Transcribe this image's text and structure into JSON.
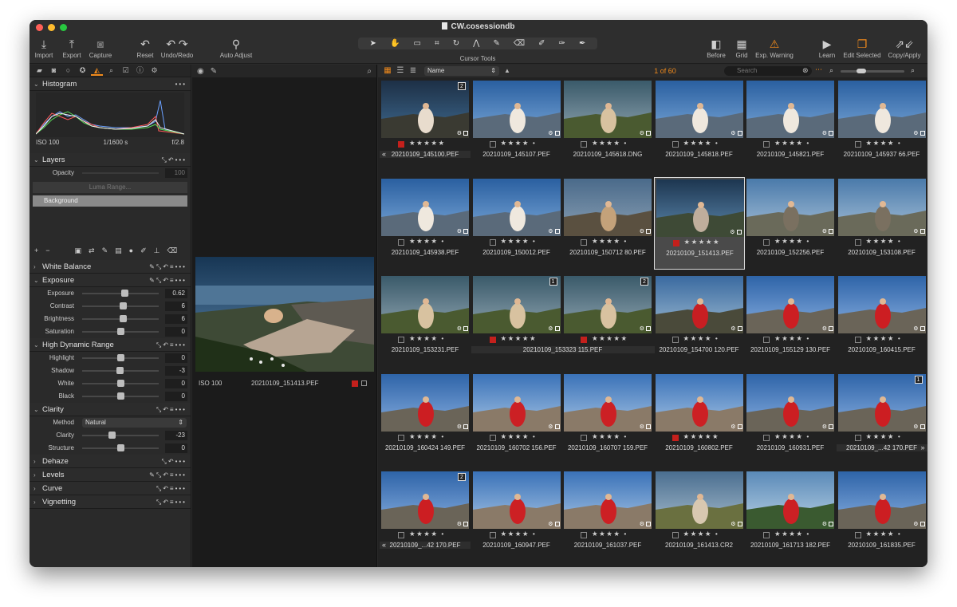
{
  "window": {
    "title": "CW.cosessiondb"
  },
  "toolbar": {
    "import_label": "Import",
    "export_label": "Export",
    "capture_label": "Capture",
    "reset_label": "Reset",
    "undo_redo_label": "Undo/Redo",
    "auto_adjust_label": "Auto Adjust",
    "cursor_tools_label": "Cursor Tools",
    "before_label": "Before",
    "grid_label": "Grid",
    "exp_warning_label": "Exp. Warning",
    "learn_label": "Learn",
    "edit_selected_label": "Edit Selected",
    "copy_apply_label": "Copy/Apply"
  },
  "histogram": {
    "title": "Histogram",
    "iso": "ISO 100",
    "shutter": "1/1600 s",
    "aperture": "f/2.8"
  },
  "layers": {
    "title": "Layers",
    "opacity_label": "Opacity",
    "opacity_value": "100",
    "luma_range_label": "Luma Range...",
    "background_label": "Background"
  },
  "white_balance": {
    "title": "White Balance"
  },
  "exposure": {
    "title": "Exposure",
    "sliders": [
      {
        "label": "Exposure",
        "value": "0.62",
        "pos": 0.55
      },
      {
        "label": "Contrast",
        "value": "6",
        "pos": 0.53
      },
      {
        "label": "Brightness",
        "value": "6",
        "pos": 0.53
      },
      {
        "label": "Saturation",
        "value": "0",
        "pos": 0.5
      }
    ]
  },
  "hdr": {
    "title": "High Dynamic Range",
    "sliders": [
      {
        "label": "Highlight",
        "value": "0",
        "pos": 0.5
      },
      {
        "label": "Shadow",
        "value": "-3",
        "pos": 0.49
      },
      {
        "label": "White",
        "value": "0",
        "pos": 0.5
      },
      {
        "label": "Black",
        "value": "0",
        "pos": 0.5
      }
    ]
  },
  "clarity": {
    "title": "Clarity",
    "method_label": "Method",
    "method_value": "Natural",
    "sliders": [
      {
        "label": "Clarity",
        "value": "-23",
        "pos": 0.39
      },
      {
        "label": "Structure",
        "value": "0",
        "pos": 0.5
      }
    ]
  },
  "dehaze": {
    "title": "Dehaze"
  },
  "levels": {
    "title": "Levels"
  },
  "curve": {
    "title": "Curve"
  },
  "vignetting": {
    "title": "Vignetting"
  },
  "viewer": {
    "iso": "ISO 100",
    "filename": "20210109_151413.PEF"
  },
  "browser": {
    "sort_value": "Name",
    "count": "1 of 60",
    "search_placeholder": "Search"
  },
  "thumbnails": [
    {
      "fn": "20210109_145100.PEF",
      "stars": "★★★★★",
      "red": true,
      "badge": "2",
      "arrow": "left",
      "stack": true,
      "tone": "a"
    },
    {
      "fn": "20210109_145107.PEF",
      "stars": "★★★★ •",
      "red": false,
      "tone": "b"
    },
    {
      "fn": "20210109_145618.DNG",
      "stars": "★★★★ •",
      "red": false,
      "tone": "c"
    },
    {
      "fn": "20210109_145818.PEF",
      "stars": "★★★★ •",
      "red": false,
      "tone": "b"
    },
    {
      "fn": "20210109_145821.PEF",
      "stars": "★★★★ •",
      "red": false,
      "tone": "b"
    },
    {
      "fn": "20210109_145937 66.PEF",
      "stars": "★★★★ •",
      "red": false,
      "tone": "b"
    },
    {
      "fn": "20210109_145938.PEF",
      "stars": "★★★★ •",
      "red": false,
      "tone": "b"
    },
    {
      "fn": "20210109_150012.PEF",
      "stars": "★★★★ •",
      "red": false,
      "tone": "b"
    },
    {
      "fn": "20210109_150712 80.PEF",
      "stars": "★★★★ •",
      "red": false,
      "tone": "d"
    },
    {
      "fn": "20210109_151413.PEF",
      "stars": "★★★★★",
      "red": true,
      "selected": true,
      "tone": "e"
    },
    {
      "fn": "20210109_152256.PEF",
      "stars": "★★★★ •",
      "red": false,
      "tone": "f"
    },
    {
      "fn": "20210109_153108.PEF",
      "stars": "★★★★ •",
      "red": false,
      "tone": "f"
    },
    {
      "fn": "20210109_153231.PEF",
      "stars": "★★★★ •",
      "red": false,
      "tone": "c"
    },
    {
      "fn": "20210109_153323 115.PEF",
      "stars": "★★★★★",
      "red": true,
      "badge": "1",
      "stack": true,
      "tone": "c",
      "span": true
    },
    {
      "fn": "",
      "stars": "★★★★★",
      "red": true,
      "badge": "2",
      "stack": true,
      "tone": "c"
    },
    {
      "fn": "20210109_154700 120.PEF",
      "stars": "★★★★ •",
      "red": false,
      "tone": "g"
    },
    {
      "fn": "20210109_155129 130.PEF",
      "stars": "★★★★ •",
      "red": false,
      "tone": "h"
    },
    {
      "fn": "20210109_160415.PEF",
      "stars": "★★★★ •",
      "red": false,
      "tone": "h"
    },
    {
      "fn": "20210109_160424 149.PEF",
      "stars": "★★★★ •",
      "red": false,
      "tone": "h"
    },
    {
      "fn": "20210109_160702 156.PEF",
      "stars": "★★★★ •",
      "red": false,
      "tone": "i"
    },
    {
      "fn": "20210109_160707 159.PEF",
      "stars": "★★★★ •",
      "red": false,
      "tone": "i"
    },
    {
      "fn": "20210109_160802.PEF",
      "stars": "★★★★★",
      "red": true,
      "tone": "i"
    },
    {
      "fn": "20210109_160931.PEF",
      "stars": "★★★★ •",
      "red": false,
      "tone": "h"
    },
    {
      "fn": "20210109_...42 170.PEF",
      "stars": "★★★★ •",
      "red": false,
      "badge": "1",
      "arrow": "right",
      "stack": true,
      "tone": "h"
    },
    {
      "fn": "20210109_...42 170.PEF",
      "stars": "★★★★ •",
      "red": false,
      "badge": "2",
      "arrow": "left",
      "stack": true,
      "tone": "h"
    },
    {
      "fn": "20210109_160947.PEF",
      "stars": "★★★★ •",
      "red": false,
      "tone": "i"
    },
    {
      "fn": "20210109_161037.PEF",
      "stars": "★★★★ •",
      "red": false,
      "tone": "i"
    },
    {
      "fn": "20210109_161413.CR2",
      "stars": "★★★★ •",
      "red": false,
      "tone": "j"
    },
    {
      "fn": "20210109_161713 182.PEF",
      "stars": "★★★★ •",
      "red": false,
      "tone": "k"
    },
    {
      "fn": "20210109_161835.PEF",
      "stars": "★★★★ •",
      "red": false,
      "tone": "h"
    }
  ]
}
